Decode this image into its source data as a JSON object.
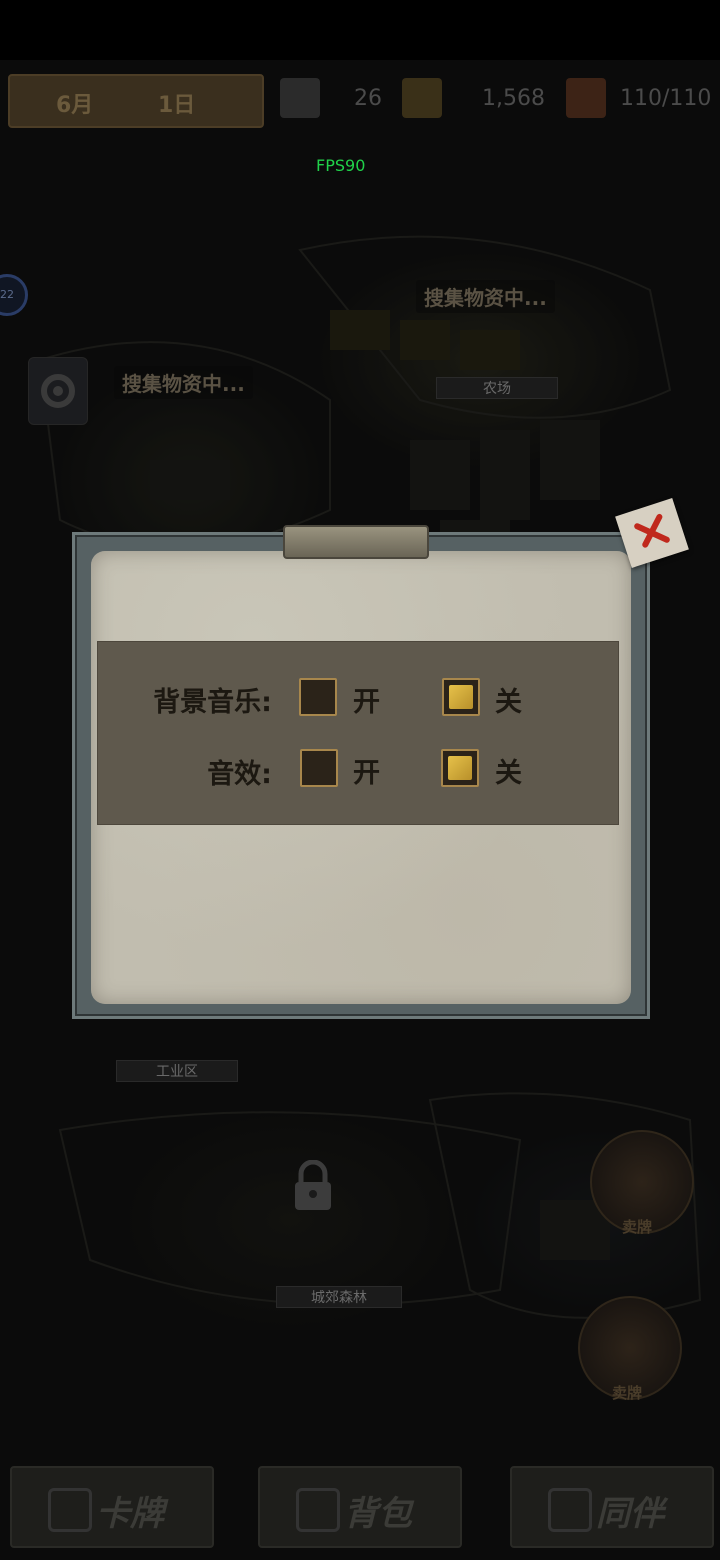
{
  "status": {
    "month": "6月",
    "day": "1日",
    "survivors": "26",
    "coins": "1,568",
    "cards": "110/110"
  },
  "fps": "FPS90",
  "map": {
    "labels": {
      "gathering_1": "搜集物资中...",
      "gathering_2": "搜集物资中..."
    },
    "zones": {
      "farm": "农场",
      "industrial": "工业区",
      "forest": "城郊森林"
    },
    "badge": "22",
    "ship_labels": {
      "top": "卖牌",
      "bottom": "卖牌"
    }
  },
  "bottom_nav": {
    "cards": "卡牌",
    "bag": "背包",
    "partner": "同伴"
  },
  "settings": {
    "music_label": "背景音乐:",
    "sfx_label": "音效:",
    "on_label": "开",
    "off_label": "关",
    "music_on_checked": "false",
    "music_off_checked": "true",
    "sfx_on_checked": "false",
    "sfx_off_checked": "true"
  },
  "colors": {
    "fps": "#20d24a",
    "checkbox_fill": "#e6c14a"
  }
}
